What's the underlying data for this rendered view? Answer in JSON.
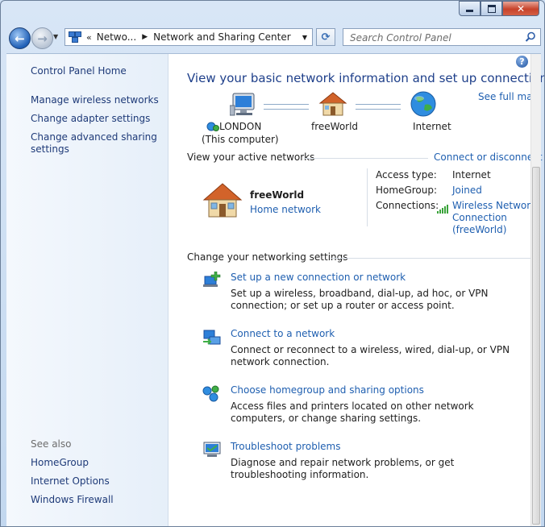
{
  "window": {
    "close_glyph": "✕"
  },
  "nav": {
    "back_glyph": "←",
    "forward_glyph": "→",
    "address": [
      "Netwo...",
      "Network and Sharing Center"
    ],
    "search_placeholder": "Search Control Panel"
  },
  "sidebar": {
    "home": "Control Panel Home",
    "links": [
      "Manage wireless networks",
      "Change adapter settings",
      "Change advanced sharing settings"
    ],
    "see_also_label": "See also",
    "see_also": [
      "HomeGroup",
      "Internet Options",
      "Windows Firewall"
    ]
  },
  "main": {
    "help_glyph": "?",
    "title": "View your basic network information and set up connections",
    "see_full_map": "See full map",
    "map": {
      "computer_name": "LONDON",
      "computer_sub": "(This computer)",
      "network_name": "freeWorld",
      "internet": "Internet"
    },
    "active_label": "View your active networks",
    "connect_disconnect": "Connect or disconnect",
    "network": {
      "name": "freeWorld",
      "type": "Home network",
      "access_type_label": "Access type:",
      "access_type_value": "Internet",
      "homegroup_label": "HomeGroup:",
      "homegroup_value": "Joined",
      "connections_label": "Connections:",
      "connections_value": [
        "Wireless Network",
        "Connection",
        "(freeWorld)"
      ]
    },
    "change_label": "Change your networking settings",
    "tasks": [
      {
        "title": "Set up a new connection or network",
        "desc": "Set up a wireless, broadband, dial-up, ad hoc, or VPN connection; or set up a router or access point."
      },
      {
        "title": "Connect to a network",
        "desc": "Connect or reconnect to a wireless, wired, dial-up, or VPN network connection."
      },
      {
        "title": "Choose homegroup and sharing options",
        "desc": "Access files and printers located on other network computers, or change sharing settings."
      },
      {
        "title": "Troubleshoot problems",
        "desc": "Diagnose and repair network problems, or get troubleshooting information."
      }
    ]
  },
  "colors": {
    "link": "#1f5fb0",
    "title": "#1e3f8a",
    "sidebar_link": "#1e3a78"
  }
}
